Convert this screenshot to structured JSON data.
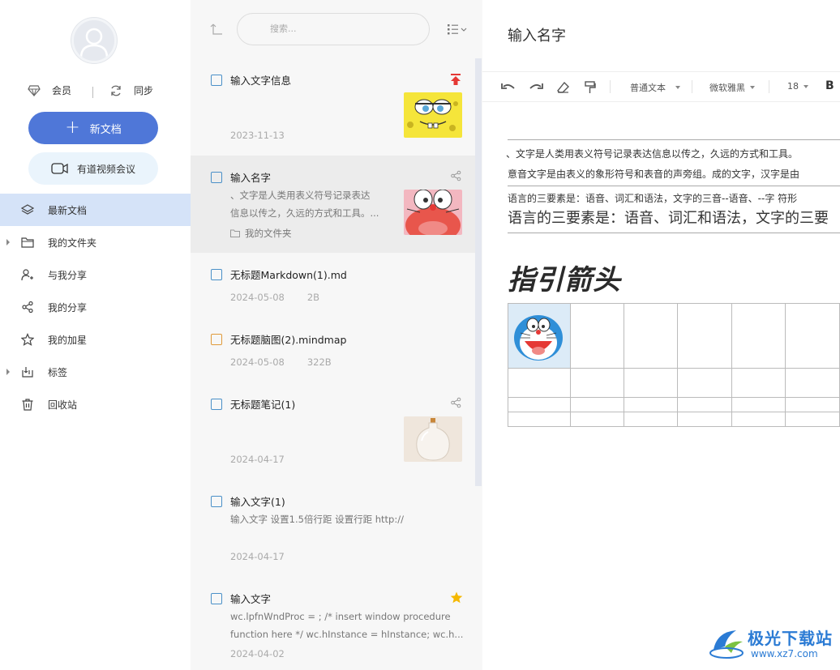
{
  "sidebar": {
    "vip_label": "会员",
    "sync_label": "同步",
    "new_doc_label": "新文档",
    "meeting_label": "有道视频会议",
    "nav": [
      {
        "label": "最新文档",
        "icon": "layers-icon",
        "active": true
      },
      {
        "label": "我的文件夹",
        "icon": "folder-icon",
        "expandable": true
      },
      {
        "label": "与我分享",
        "icon": "shared-with-me-icon"
      },
      {
        "label": "我的分享",
        "icon": "share-icon"
      },
      {
        "label": "我的加星",
        "icon": "star-icon"
      },
      {
        "label": "标签",
        "icon": "tag-icon",
        "expandable": true
      },
      {
        "label": "回收站",
        "icon": "trash-icon"
      }
    ]
  },
  "list": {
    "search_placeholder": "搜索...",
    "notes": [
      {
        "title": "输入文字信息",
        "snippet": [],
        "folder": "",
        "date": "2023-11-13",
        "size": "",
        "type": "note",
        "badge": "pin-top-icon",
        "thumb": "sponge-thumbnail"
      },
      {
        "title": "输入名字",
        "snippet": [
          "、文字是人类用表义符号记录表达",
          "信息以传之，久远的方式和工具。..."
        ],
        "folder": "我的文件夹",
        "date": "",
        "size": "",
        "type": "note",
        "badge": "share-icon",
        "thumb": "doraemon-thumbnail"
      },
      {
        "title": "无标题Markdown(1).md",
        "snippet": [],
        "folder": "",
        "date": "2024-05-08",
        "size": "2B",
        "type": "markdown",
        "badge": "",
        "thumb": ""
      },
      {
        "title": "无标题脑图(2).mindmap",
        "snippet": [],
        "folder": "",
        "date": "2024-05-08",
        "size": "322B",
        "type": "mindmap",
        "badge": "",
        "thumb": ""
      },
      {
        "title": "无标题笔记(1)",
        "snippet": [],
        "folder": "",
        "date": "2024-04-17",
        "size": "",
        "type": "note",
        "badge": "share-icon",
        "thumb": "bottle-thumbnail"
      },
      {
        "title": "输入文字(1)",
        "snippet": [
          "输入文字 设置1.5倍行距 设置行距 http://"
        ],
        "folder": "",
        "date": "2024-04-17",
        "size": "",
        "type": "note",
        "badge": "",
        "thumb": ""
      },
      {
        "title": "输入文字",
        "snippet": [
          "wc.lpfnWndProc = ; /* insert window procedure",
          "function here */ wc.hInstance = hInstance; wc.h..."
        ],
        "folder": "",
        "date": "2024-04-02",
        "size": "",
        "type": "note",
        "badge": "star-icon",
        "thumb": ""
      }
    ]
  },
  "editor": {
    "title": "输入名字",
    "toolbar": {
      "paragraph_style": "普通文本",
      "font": "微软雅黑",
      "font_size": "18",
      "bold": "B"
    },
    "body_lines": [
      "、文字是人类用表义符号记录表达信息以传之，久远的方式和工具。",
      "意音文字是由表义的象形符号和表音的声旁组。成的文字，汉字是由",
      "语言的三要素是：语音、词汇和语法，文字的三音--语音、--字 符形",
      "语言的三要素是：语音、词汇和语法，文字的三要"
    ],
    "heading": "指引箭头"
  },
  "watermark": {
    "line1": "极光下载站",
    "line2": "www.xz7.com"
  },
  "colors": {
    "accent": "#4f77d8",
    "nav_active": "#d5e3f8",
    "list_bg": "#f7f7f7",
    "pin_red": "#e53935",
    "star_yellow": "#f5b800"
  }
}
